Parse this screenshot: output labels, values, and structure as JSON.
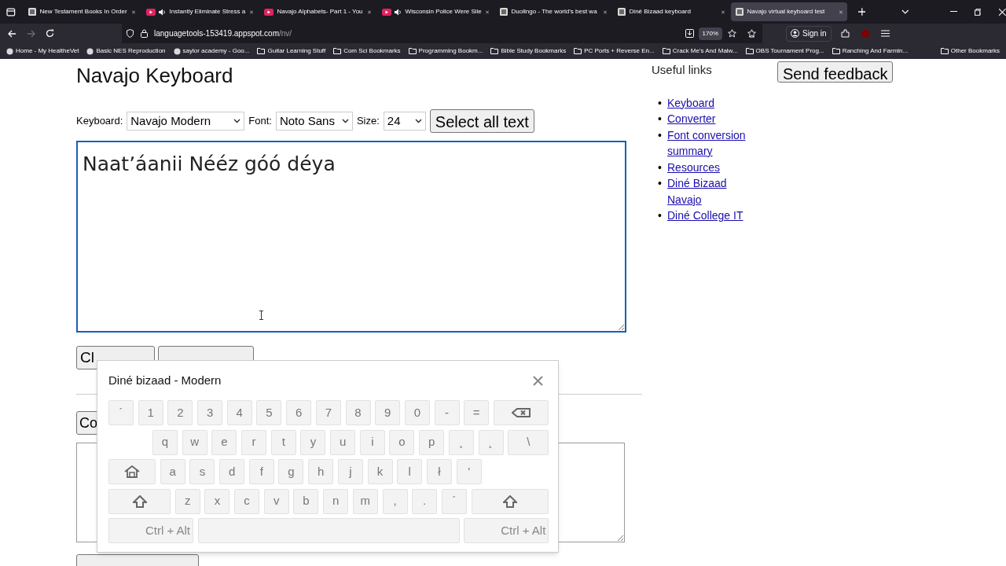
{
  "tabs": [
    {
      "title": "New Testament Books In Order",
      "kind": "page",
      "audio": false,
      "selected": false
    },
    {
      "title": "Instantly Eliminate Stress a",
      "kind": "video",
      "audio": true,
      "selected": false
    },
    {
      "title": "Navajo Alphabets- Part 1 - You",
      "kind": "video",
      "audio": false,
      "selected": false
    },
    {
      "title": "Wisconsin Police Were Sile",
      "kind": "video",
      "audio": true,
      "selected": false
    },
    {
      "title": "Duolingo - The world's best wa",
      "kind": "page",
      "audio": false,
      "selected": false
    },
    {
      "title": "Diné Bizaad keyboard",
      "kind": "page",
      "audio": false,
      "selected": false
    },
    {
      "title": "Navajo virtual keyboard test",
      "kind": "page",
      "audio": false,
      "selected": true
    }
  ],
  "address": {
    "host": "languagetools-153419.appspot.com",
    "path": "/nv/"
  },
  "zoom": "170%",
  "sign_in": "Sign in",
  "bookmarks": [
    {
      "label": "Home - My HealtheVet",
      "kind": "site"
    },
    {
      "label": "Basic NES Reproduction",
      "kind": "site"
    },
    {
      "label": "saylor academy - Goo...",
      "kind": "site"
    },
    {
      "label": "Guitar Learning Stuff",
      "kind": "folder"
    },
    {
      "label": "Com Sci Bookmarks",
      "kind": "folder"
    },
    {
      "label": "Programming Bookm...",
      "kind": "folder"
    },
    {
      "label": "Bible Study Bookmarks",
      "kind": "folder"
    },
    {
      "label": "PC Ports + Reverse En...",
      "kind": "folder"
    },
    {
      "label": "Crack Me's And Malw...",
      "kind": "folder"
    },
    {
      "label": "OBS Tournament Prog...",
      "kind": "folder"
    },
    {
      "label": "Ranching And Farmin...",
      "kind": "folder"
    }
  ],
  "other_bookmarks": "Other Bookmarks",
  "heading": "Navajo Keyboard",
  "controls": [
    {
      "label": "Keyboard:",
      "value": "Navajo Modern"
    },
    {
      "label": "Font:",
      "value": "Noto Sans"
    },
    {
      "label": "Size:",
      "value": "24"
    }
  ],
  "select_all_button": "Select all text",
  "editor_text": "Naatʼáanii Nééz góó déya",
  "clear_button": "Cl",
  "second_button": "Co",
  "useful_links": {
    "title": "Useful links",
    "links": [
      {
        "bullet": "•",
        "label": "Keyboard"
      },
      {
        "bullet": "•",
        "label": "Converter"
      },
      {
        "bullet": "•",
        "label": "Font conversion summary"
      },
      {
        "bullet": "•",
        "label": "Resources"
      },
      {
        "bullet": "•",
        "label": "Diné Bizaad Navajo"
      },
      {
        "bullet": "•",
        "label": "Diné College IT"
      }
    ]
  },
  "feedback_button": "Send feedback",
  "virtual_keyboard": {
    "title": "Diné bizaad - Modern",
    "key_rows": [
      {
        "keys": [
          {
            "kind": "char",
            "label": "´"
          },
          {
            "kind": "char",
            "label": "1"
          },
          {
            "kind": "char",
            "label": "2"
          },
          {
            "kind": "char",
            "label": "3"
          },
          {
            "kind": "char",
            "label": "4"
          },
          {
            "kind": "char",
            "label": "5"
          },
          {
            "kind": "char",
            "label": "6"
          },
          {
            "kind": "char",
            "label": "7"
          },
          {
            "kind": "char",
            "label": "8"
          },
          {
            "kind": "char",
            "label": "9"
          },
          {
            "kind": "char",
            "label": "0"
          },
          {
            "kind": "char",
            "label": "-"
          },
          {
            "kind": "char",
            "label": "="
          },
          {
            "kind": "backspace"
          }
        ]
      },
      {
        "keys": [
          {
            "kind": "indent"
          },
          {
            "kind": "char",
            "label": "q"
          },
          {
            "kind": "char",
            "label": "w"
          },
          {
            "kind": "char",
            "label": "e"
          },
          {
            "kind": "char",
            "label": "r"
          },
          {
            "kind": "char",
            "label": "t"
          },
          {
            "kind": "char",
            "label": "y"
          },
          {
            "kind": "char",
            "label": "u"
          },
          {
            "kind": "char",
            "label": "i"
          },
          {
            "kind": "char",
            "label": "o"
          },
          {
            "kind": "char",
            "label": "p"
          },
          {
            "kind": "char",
            "label": "¸"
          },
          {
            "kind": "char",
            "label": "˛"
          },
          {
            "kind": "wide",
            "label": "\\"
          }
        ]
      },
      {
        "keys": [
          {
            "kind": "home"
          },
          {
            "kind": "char",
            "label": "a"
          },
          {
            "kind": "char",
            "label": "s"
          },
          {
            "kind": "char",
            "label": "d"
          },
          {
            "kind": "char",
            "label": "f"
          },
          {
            "kind": "char",
            "label": "g"
          },
          {
            "kind": "char",
            "label": "h"
          },
          {
            "kind": "char",
            "label": "j"
          },
          {
            "kind": "char",
            "label": "k"
          },
          {
            "kind": "char",
            "label": "l"
          },
          {
            "kind": "char",
            "label": "ł"
          },
          {
            "kind": "char",
            "label": "'"
          }
        ]
      },
      {
        "keys": [
          {
            "kind": "shift"
          },
          {
            "kind": "char",
            "label": "z"
          },
          {
            "kind": "char",
            "label": "x"
          },
          {
            "kind": "char",
            "label": "c"
          },
          {
            "kind": "char",
            "label": "v"
          },
          {
            "kind": "char",
            "label": "b"
          },
          {
            "kind": "char",
            "label": "n"
          },
          {
            "kind": "char",
            "label": "m"
          },
          {
            "kind": "char",
            "label": ","
          },
          {
            "kind": "char",
            "label": "."
          },
          {
            "kind": "char",
            "label": "´"
          },
          {
            "kind": "shift_right"
          }
        ]
      },
      {
        "keys": [
          {
            "kind": "ctrl",
            "label": "Ctrl + Alt"
          },
          {
            "kind": "space"
          },
          {
            "kind": "ctrl",
            "label": "Ctrl + Alt"
          }
        ]
      }
    ]
  }
}
